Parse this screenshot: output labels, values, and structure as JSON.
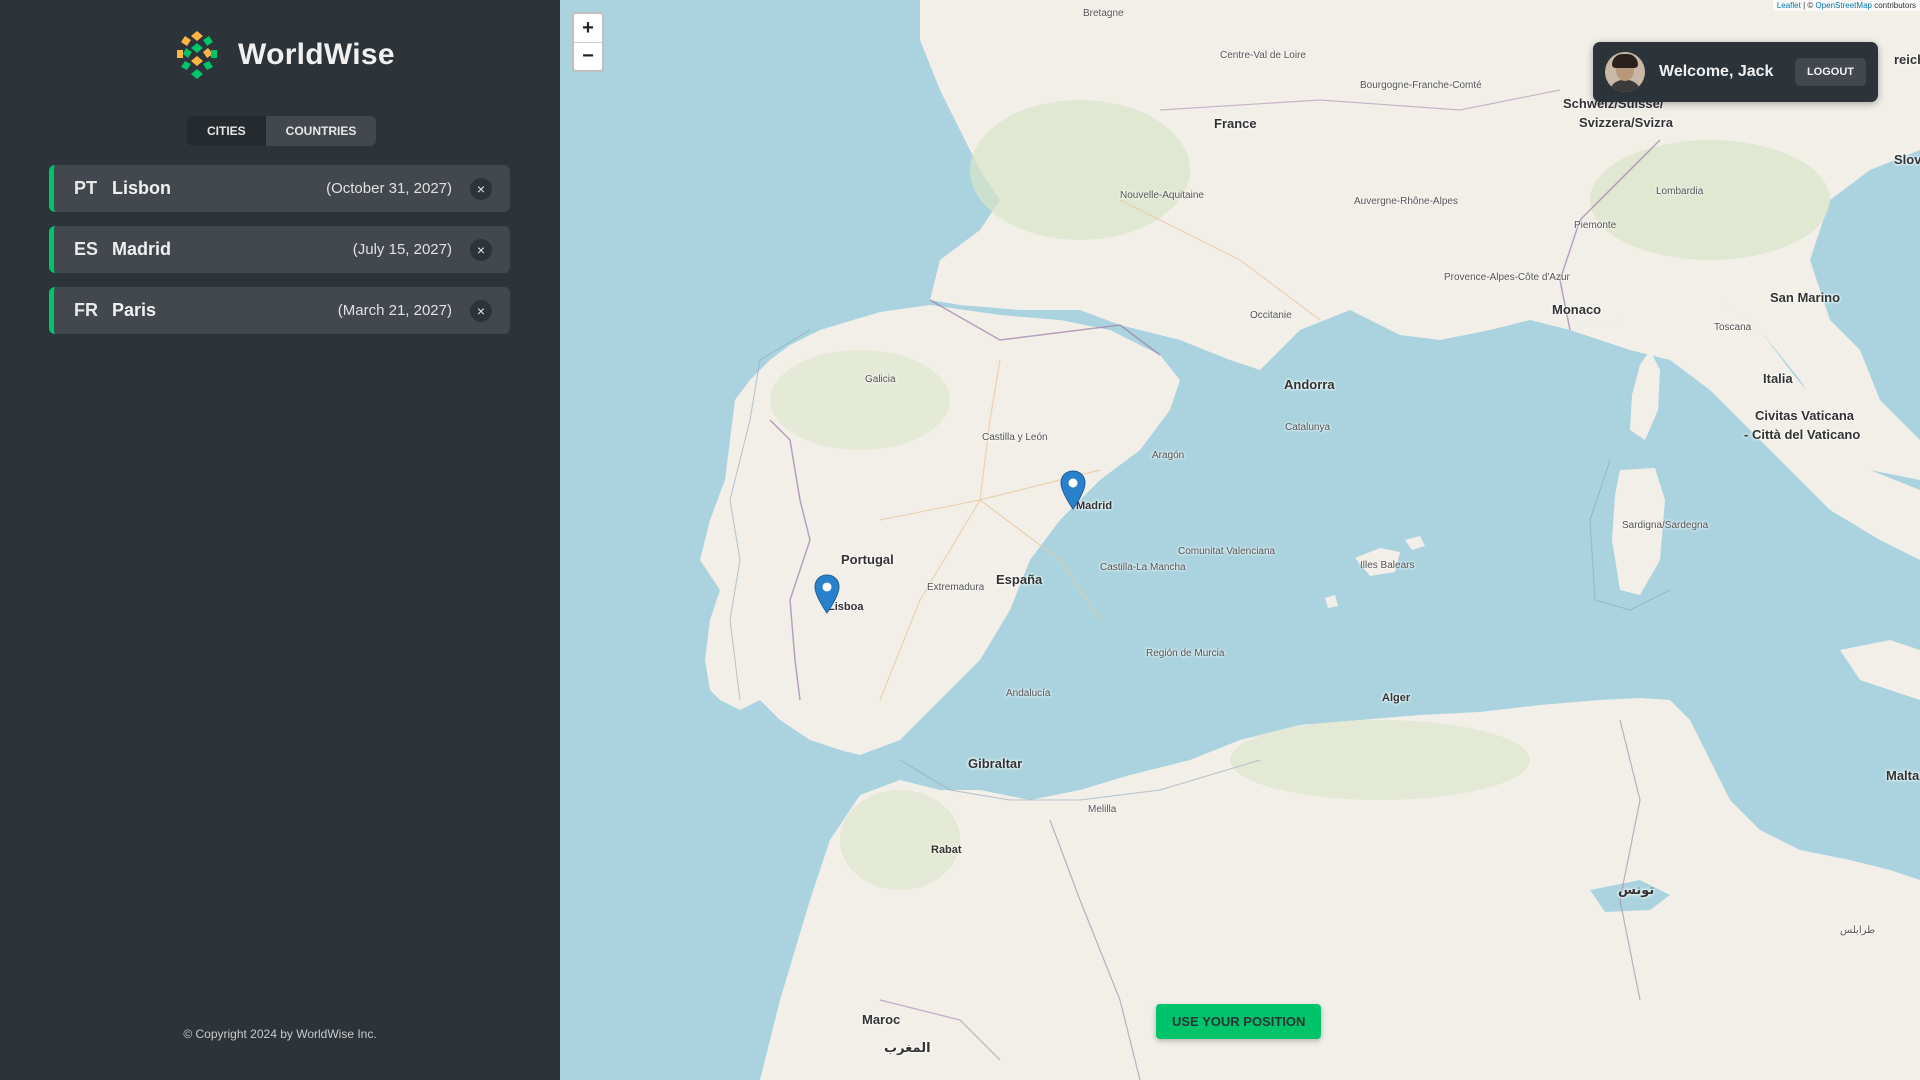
{
  "app": {
    "name": "WorldWise",
    "copyright": "© Copyright 2024 by WorldWise Inc."
  },
  "tabs": [
    {
      "label": "Cities",
      "active": true
    },
    {
      "label": "Countries",
      "active": false
    }
  ],
  "cities": [
    {
      "flag": "PT",
      "name": "Lisbon",
      "date": "(October 31, 2027)",
      "delete": "×"
    },
    {
      "flag": "ES",
      "name": "Madrid",
      "date": "(July 15, 2027)",
      "delete": "×"
    },
    {
      "flag": "FR",
      "name": "Paris",
      "date": "(March 21, 2027)",
      "delete": "×"
    }
  ],
  "user": {
    "welcome": "Welcome, Jack",
    "logout": "Logout"
  },
  "map": {
    "zoom_in": "+",
    "zoom_out": "−",
    "attribution_leaflet": "Leaflet",
    "attribution_osm": "OpenStreetMap",
    "attribution_suffix": "contributors",
    "use_position": "Use your position",
    "labels": {
      "france": "France",
      "andorra": "Andorra",
      "monaco": "Monaco",
      "portugal": "Portugal",
      "espana": "España",
      "gibraltar": "Gibraltar",
      "italia": "Italia",
      "san_marino": "San Marino",
      "vaticano_1": "Civitas Vaticana",
      "vaticano_2": "- Città del Vaticano",
      "schweiz_1": "Schweiz/Suisse/",
      "schweiz_2": "Svizzera/Svizra",
      "malta": "Malta",
      "alger": "Alger",
      "maroc": "Maroc",
      "rabat": "Rabat",
      "madrid": "Madrid",
      "lisboa": "Lisboa",
      "tunis_ar": "تونس",
      "slove": "Slove",
      "reich": "reich",
      "maghrib": "المغرب",
      "bretagne": "Bretagne",
      "galicia": "Galicia",
      "aragon": "Aragón",
      "cataluna": "Catalunya",
      "andalucia": "Andalucía",
      "extremadura": "Extremadura",
      "castilla_mancha": "Castilla-La Mancha",
      "castilla_leon": "Castilla y León",
      "valenciana": "Comunitat Valenciana",
      "murcia": "Región de Murcia",
      "illes_balears": "Illes Balears",
      "sardegna": "Sardigna/Sardegna",
      "occitanie": "Occitanie",
      "nouvelle_aquitaine": "Nouvelle-Aquitaine",
      "auvergne": "Auvergne-Rhône-Alpes",
      "centre": "Centre-Val de Loire",
      "bourgogne": "Bourgogne-Franche-Comté",
      "provence": "Provence-Alpes-Côte d'Azur",
      "piemonte": "Piemonte",
      "lombardia": "Lombardia",
      "toscana": "Toscana",
      "melilla": "Melilla",
      "trablus": "طرابلس"
    }
  },
  "colors": {
    "accent": "#00c46a",
    "sidebar": "#2d3439",
    "item": "#42484d",
    "sea": "#aad3df",
    "land": "#f2efe9"
  },
  "icons": {
    "logo": "globe-hexagon-logo",
    "delete": "close-icon",
    "marker": "map-pin-icon"
  }
}
